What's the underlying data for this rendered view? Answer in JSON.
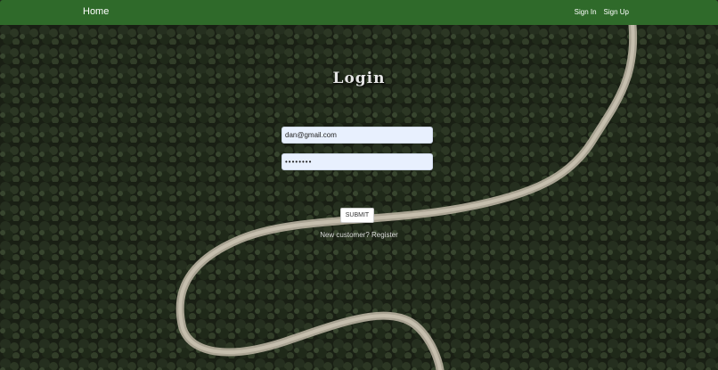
{
  "navbar": {
    "home_label": "Home",
    "links": [
      "Sign In",
      "Sign Up"
    ],
    "bg_color": "#2f6a2a"
  },
  "login": {
    "title": "Login",
    "email_value": "dan@gmail.com",
    "password_value": "••••••••",
    "submit_label": "SUBMIT",
    "register_prompt": "New customer?",
    "register_label": "Register"
  }
}
